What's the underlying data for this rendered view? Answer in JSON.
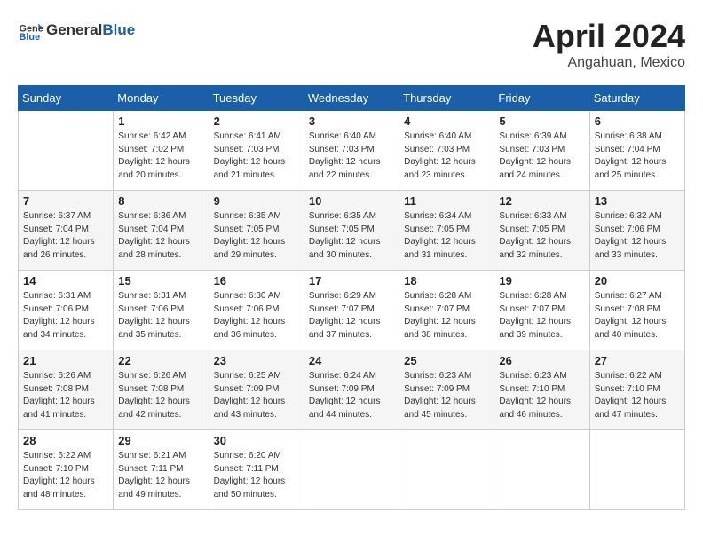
{
  "header": {
    "logo_general": "General",
    "logo_blue": "Blue",
    "month_year": "April 2024",
    "location": "Angahuan, Mexico"
  },
  "weekdays": [
    "Sunday",
    "Monday",
    "Tuesday",
    "Wednesday",
    "Thursday",
    "Friday",
    "Saturday"
  ],
  "weeks": [
    [
      {
        "day": "",
        "sunrise": "",
        "sunset": "",
        "daylight": ""
      },
      {
        "day": "1",
        "sunrise": "Sunrise: 6:42 AM",
        "sunset": "Sunset: 7:02 PM",
        "daylight": "Daylight: 12 hours and 20 minutes."
      },
      {
        "day": "2",
        "sunrise": "Sunrise: 6:41 AM",
        "sunset": "Sunset: 7:03 PM",
        "daylight": "Daylight: 12 hours and 21 minutes."
      },
      {
        "day": "3",
        "sunrise": "Sunrise: 6:40 AM",
        "sunset": "Sunset: 7:03 PM",
        "daylight": "Daylight: 12 hours and 22 minutes."
      },
      {
        "day": "4",
        "sunrise": "Sunrise: 6:40 AM",
        "sunset": "Sunset: 7:03 PM",
        "daylight": "Daylight: 12 hours and 23 minutes."
      },
      {
        "day": "5",
        "sunrise": "Sunrise: 6:39 AM",
        "sunset": "Sunset: 7:03 PM",
        "daylight": "Daylight: 12 hours and 24 minutes."
      },
      {
        "day": "6",
        "sunrise": "Sunrise: 6:38 AM",
        "sunset": "Sunset: 7:04 PM",
        "daylight": "Daylight: 12 hours and 25 minutes."
      }
    ],
    [
      {
        "day": "7",
        "sunrise": "Sunrise: 6:37 AM",
        "sunset": "Sunset: 7:04 PM",
        "daylight": "Daylight: 12 hours and 26 minutes."
      },
      {
        "day": "8",
        "sunrise": "Sunrise: 6:36 AM",
        "sunset": "Sunset: 7:04 PM",
        "daylight": "Daylight: 12 hours and 28 minutes."
      },
      {
        "day": "9",
        "sunrise": "Sunrise: 6:35 AM",
        "sunset": "Sunset: 7:05 PM",
        "daylight": "Daylight: 12 hours and 29 minutes."
      },
      {
        "day": "10",
        "sunrise": "Sunrise: 6:35 AM",
        "sunset": "Sunset: 7:05 PM",
        "daylight": "Daylight: 12 hours and 30 minutes."
      },
      {
        "day": "11",
        "sunrise": "Sunrise: 6:34 AM",
        "sunset": "Sunset: 7:05 PM",
        "daylight": "Daylight: 12 hours and 31 minutes."
      },
      {
        "day": "12",
        "sunrise": "Sunrise: 6:33 AM",
        "sunset": "Sunset: 7:05 PM",
        "daylight": "Daylight: 12 hours and 32 minutes."
      },
      {
        "day": "13",
        "sunrise": "Sunrise: 6:32 AM",
        "sunset": "Sunset: 7:06 PM",
        "daylight": "Daylight: 12 hours and 33 minutes."
      }
    ],
    [
      {
        "day": "14",
        "sunrise": "Sunrise: 6:31 AM",
        "sunset": "Sunset: 7:06 PM",
        "daylight": "Daylight: 12 hours and 34 minutes."
      },
      {
        "day": "15",
        "sunrise": "Sunrise: 6:31 AM",
        "sunset": "Sunset: 7:06 PM",
        "daylight": "Daylight: 12 hours and 35 minutes."
      },
      {
        "day": "16",
        "sunrise": "Sunrise: 6:30 AM",
        "sunset": "Sunset: 7:06 PM",
        "daylight": "Daylight: 12 hours and 36 minutes."
      },
      {
        "day": "17",
        "sunrise": "Sunrise: 6:29 AM",
        "sunset": "Sunset: 7:07 PM",
        "daylight": "Daylight: 12 hours and 37 minutes."
      },
      {
        "day": "18",
        "sunrise": "Sunrise: 6:28 AM",
        "sunset": "Sunset: 7:07 PM",
        "daylight": "Daylight: 12 hours and 38 minutes."
      },
      {
        "day": "19",
        "sunrise": "Sunrise: 6:28 AM",
        "sunset": "Sunset: 7:07 PM",
        "daylight": "Daylight: 12 hours and 39 minutes."
      },
      {
        "day": "20",
        "sunrise": "Sunrise: 6:27 AM",
        "sunset": "Sunset: 7:08 PM",
        "daylight": "Daylight: 12 hours and 40 minutes."
      }
    ],
    [
      {
        "day": "21",
        "sunrise": "Sunrise: 6:26 AM",
        "sunset": "Sunset: 7:08 PM",
        "daylight": "Daylight: 12 hours and 41 minutes."
      },
      {
        "day": "22",
        "sunrise": "Sunrise: 6:26 AM",
        "sunset": "Sunset: 7:08 PM",
        "daylight": "Daylight: 12 hours and 42 minutes."
      },
      {
        "day": "23",
        "sunrise": "Sunrise: 6:25 AM",
        "sunset": "Sunset: 7:09 PM",
        "daylight": "Daylight: 12 hours and 43 minutes."
      },
      {
        "day": "24",
        "sunrise": "Sunrise: 6:24 AM",
        "sunset": "Sunset: 7:09 PM",
        "daylight": "Daylight: 12 hours and 44 minutes."
      },
      {
        "day": "25",
        "sunrise": "Sunrise: 6:23 AM",
        "sunset": "Sunset: 7:09 PM",
        "daylight": "Daylight: 12 hours and 45 minutes."
      },
      {
        "day": "26",
        "sunrise": "Sunrise: 6:23 AM",
        "sunset": "Sunset: 7:10 PM",
        "daylight": "Daylight: 12 hours and 46 minutes."
      },
      {
        "day": "27",
        "sunrise": "Sunrise: 6:22 AM",
        "sunset": "Sunset: 7:10 PM",
        "daylight": "Daylight: 12 hours and 47 minutes."
      }
    ],
    [
      {
        "day": "28",
        "sunrise": "Sunrise: 6:22 AM",
        "sunset": "Sunset: 7:10 PM",
        "daylight": "Daylight: 12 hours and 48 minutes."
      },
      {
        "day": "29",
        "sunrise": "Sunrise: 6:21 AM",
        "sunset": "Sunset: 7:11 PM",
        "daylight": "Daylight: 12 hours and 49 minutes."
      },
      {
        "day": "30",
        "sunrise": "Sunrise: 6:20 AM",
        "sunset": "Sunset: 7:11 PM",
        "daylight": "Daylight: 12 hours and 50 minutes."
      },
      {
        "day": "",
        "sunrise": "",
        "sunset": "",
        "daylight": ""
      },
      {
        "day": "",
        "sunrise": "",
        "sunset": "",
        "daylight": ""
      },
      {
        "day": "",
        "sunrise": "",
        "sunset": "",
        "daylight": ""
      },
      {
        "day": "",
        "sunrise": "",
        "sunset": "",
        "daylight": ""
      }
    ]
  ]
}
